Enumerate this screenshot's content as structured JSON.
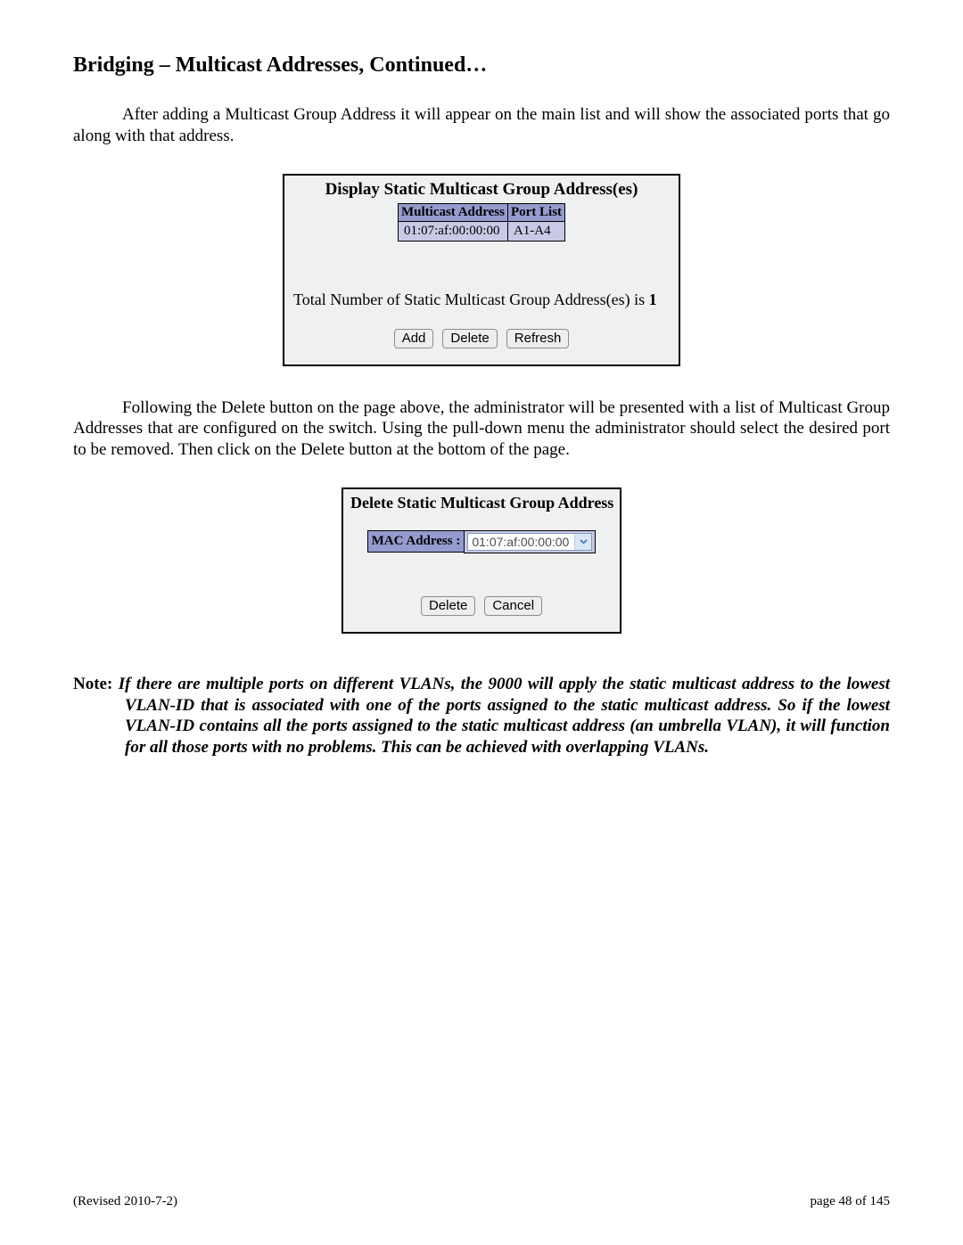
{
  "page_title": "Bridging – Multicast Addresses, Continued…",
  "paragraph_1": "After adding a Multicast Group Address it will appear on the main list and will show the associated ports that go along with that address.",
  "panel1": {
    "title": "Display Static Multicast Group Address(es)",
    "header_addr": "Multicast Address",
    "header_ports": "Port List",
    "row_addr": "01:07:af:00:00:00",
    "row_ports": "A1-A4",
    "msg_prefix": "Total Number of Static Multicast Group Address(es) is ",
    "count": "1",
    "btn_add": "Add",
    "btn_delete": "Delete",
    "btn_refresh": "Refresh"
  },
  "paragraph_2": "Following the Delete button on the page above, the administrator will be presented with a list of Multicast Group Addresses that are configured on the switch.  Using the pull-down menu the administrator should select the desired port to be removed.  Then click on the Delete button at the bottom of the page.",
  "panel2": {
    "title": "Delete Static Multicast Group Address",
    "label": "MAC Address :",
    "selected": "01:07:af:00:00:00",
    "btn_delete": "Delete",
    "btn_cancel": "Cancel"
  },
  "note": {
    "label": "Note: ",
    "body": "If there are multiple ports on different VLANs, the 9000 will apply the static multicast address to the lowest VLAN-ID that is associated with one of the ports assigned to the static multicast address.  So if the lowest VLAN-ID contains all the ports assigned to the static multicast address (an umbrella VLAN), it will function for all those ports with no problems.  This can be achieved with overlapping VLANs."
  },
  "footer": {
    "left": "(Revised 2010-7-2)",
    "right": "page 48 of 145"
  }
}
